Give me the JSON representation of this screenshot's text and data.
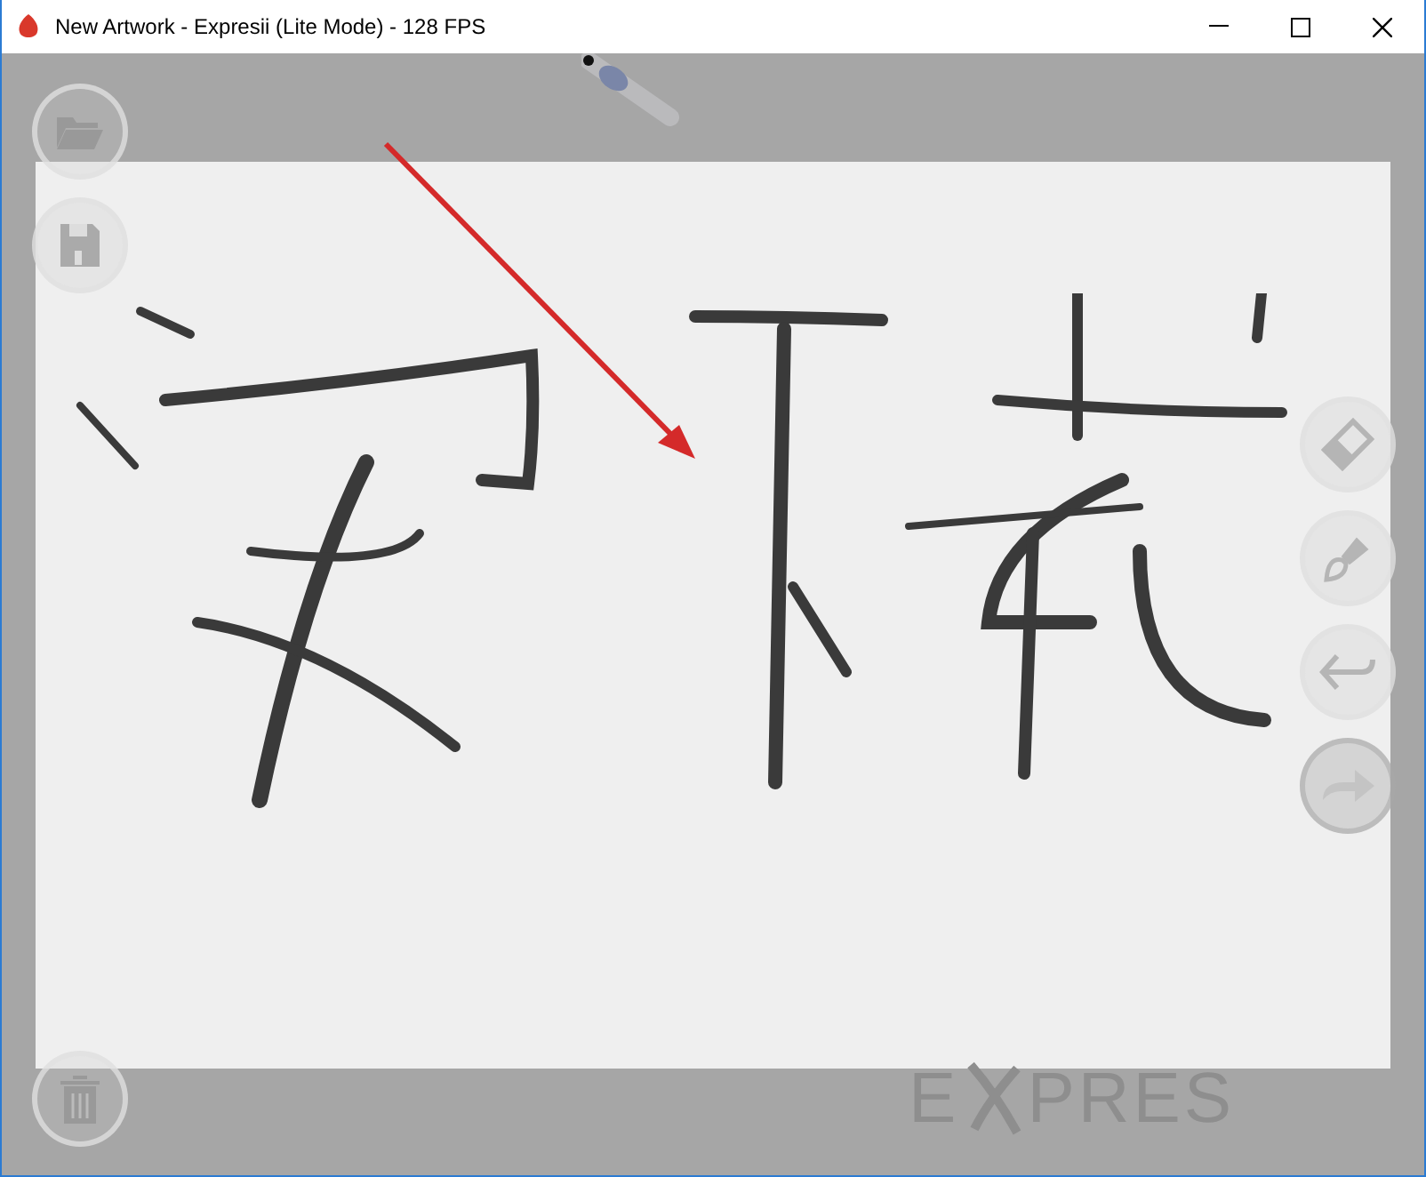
{
  "window": {
    "title": "New Artwork - Expresii (Lite Mode) - 128 FPS"
  },
  "left_tools": [
    {
      "kind": "open",
      "disabled": false
    },
    {
      "kind": "save",
      "disabled": false
    },
    {
      "kind": "trash",
      "disabled": false
    }
  ],
  "right_tools": [
    {
      "kind": "eraser",
      "disabled": false
    },
    {
      "kind": "brush",
      "disabled": false
    },
    {
      "kind": "undo",
      "disabled": false
    },
    {
      "kind": "redo",
      "disabled": true
    }
  ],
  "logo": {
    "before": "E",
    "after": "PRES"
  }
}
